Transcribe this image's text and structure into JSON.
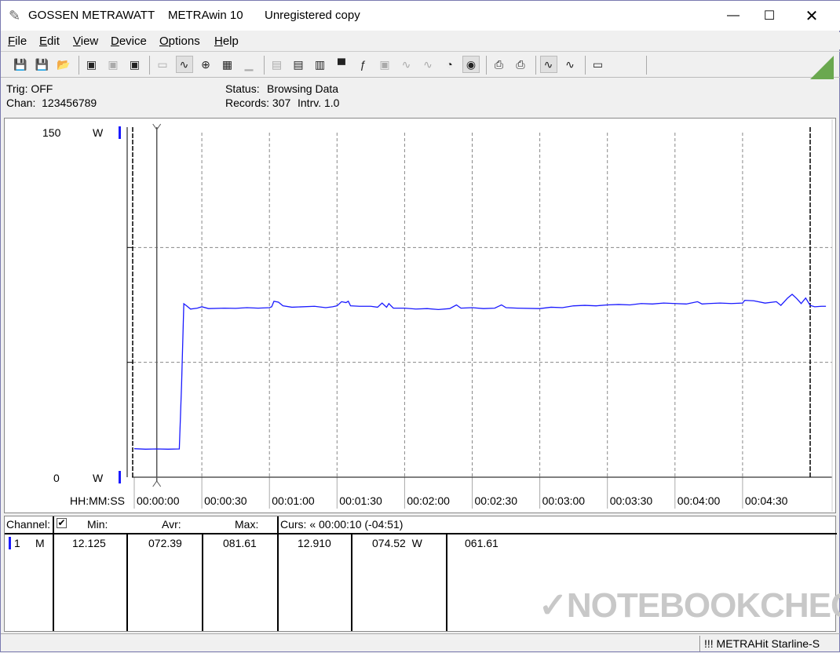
{
  "title": {
    "brand": "GOSSEN METRAWATT",
    "app": "METRAwin 10",
    "license": "Unregistered copy"
  },
  "menu": [
    {
      "label": "File",
      "key": "F"
    },
    {
      "label": "Edit",
      "key": "E"
    },
    {
      "label": "View",
      "key": "V"
    },
    {
      "label": "Device",
      "key": "D"
    },
    {
      "label": "Options",
      "key": "O"
    },
    {
      "label": "Help",
      "key": "H"
    }
  ],
  "toolbar": {
    "icons": [
      "save-as-icon",
      "save-icon",
      "open-folder-icon",
      "device-read-icon",
      "device-clear-icon",
      "memory-read-icon",
      "multimeter-icon",
      "waveform-view-icon",
      "crosshair-icon",
      "table-view-icon",
      "bar-chart-icon",
      "export-icon",
      "import-icon",
      "settings-icon",
      "monitor-icon",
      "function-icon",
      "display-icon",
      "sine-icon",
      "sine-bars-icon",
      "clock-icon",
      "timer-icon",
      "print-preview-icon",
      "print-icon",
      "zoom-wave-icon",
      "zoom-fit-icon",
      "comment-icon"
    ]
  },
  "info": {
    "trig": "Trig: OFF",
    "chan": "Chan:  123456789",
    "status_label": "Status:",
    "status_value": "Browsing Data",
    "records": "Records: 307",
    "interval": "Intrv. 1.0"
  },
  "chart_data": {
    "type": "line",
    "ylabel": "W",
    "ylim": [
      0,
      150
    ],
    "ytick_labels": [
      "150",
      "0"
    ],
    "yunit_top": "W",
    "yunit_bottom": "W",
    "xlabel": "HH:MM:SS",
    "xlim": [
      0,
      307
    ],
    "xticks": [
      0,
      30,
      60,
      90,
      120,
      150,
      180,
      210,
      240,
      270
    ],
    "xtick_labels": [
      "00:00:00",
      "00:00:30",
      "00:01:00",
      "00:01:30",
      "00:02:00",
      "00:02:30",
      "00:03:00",
      "00:03:30",
      "00:04:00",
      "00:04:30"
    ],
    "cursor_t": 10,
    "line_color": "#1a1aff",
    "series": [
      {
        "name": "Channel 1",
        "points": [
          [
            0,
            12.4
          ],
          [
            5,
            12.2
          ],
          [
            10,
            12.3
          ],
          [
            15,
            12.2
          ],
          [
            20,
            12.3
          ],
          [
            21,
            40
          ],
          [
            22,
            75.5
          ],
          [
            23,
            74.8
          ],
          [
            25,
            73.2
          ],
          [
            28,
            73.6
          ],
          [
            30,
            74.2
          ],
          [
            33,
            73.4
          ],
          [
            40,
            73.6
          ],
          [
            45,
            73.5
          ],
          [
            50,
            73.8
          ],
          [
            55,
            73.6
          ],
          [
            60,
            73.8
          ],
          [
            61,
            74.2
          ],
          [
            62,
            76.6
          ],
          [
            64,
            76.2
          ],
          [
            66,
            74.6
          ],
          [
            70,
            74.0
          ],
          [
            80,
            74.4
          ],
          [
            85,
            73.8
          ],
          [
            88,
            74.2
          ],
          [
            90,
            74.6
          ],
          [
            92,
            76.4
          ],
          [
            94,
            76.0
          ],
          [
            95,
            76.6
          ],
          [
            96,
            74.6
          ],
          [
            100,
            74.4
          ],
          [
            105,
            74.4
          ],
          [
            108,
            74.0
          ],
          [
            110,
            75.8
          ],
          [
            112,
            74.0
          ],
          [
            113,
            75.6
          ],
          [
            115,
            73.6
          ],
          [
            120,
            73.6
          ],
          [
            125,
            73.2
          ],
          [
            130,
            73.4
          ],
          [
            135,
            73.0
          ],
          [
            140,
            73.4
          ],
          [
            143,
            75.0
          ],
          [
            145,
            73.6
          ],
          [
            150,
            73.8
          ],
          [
            155,
            73.4
          ],
          [
            160,
            73.6
          ],
          [
            163,
            75.0
          ],
          [
            165,
            73.8
          ],
          [
            170,
            73.6
          ],
          [
            180,
            73.4
          ],
          [
            185,
            74.0
          ],
          [
            190,
            73.8
          ],
          [
            195,
            74.6
          ],
          [
            200,
            74.8
          ],
          [
            205,
            74.6
          ],
          [
            210,
            75.0
          ],
          [
            215,
            75.2
          ],
          [
            220,
            75.0
          ],
          [
            225,
            75.6
          ],
          [
            230,
            75.4
          ],
          [
            235,
            75.8
          ],
          [
            240,
            75.6
          ],
          [
            245,
            75.4
          ],
          [
            250,
            76.4
          ],
          [
            252,
            75.4
          ],
          [
            255,
            75.6
          ],
          [
            260,
            75.8
          ],
          [
            265,
            75.6
          ],
          [
            270,
            75.8
          ],
          [
            271,
            77.0
          ],
          [
            275,
            76.8
          ],
          [
            280,
            75.8
          ],
          [
            285,
            76.4
          ],
          [
            287,
            74.8
          ],
          [
            290,
            78.0
          ],
          [
            292,
            79.6
          ],
          [
            294,
            77.8
          ],
          [
            296,
            75.6
          ],
          [
            298,
            78.0
          ],
          [
            300,
            74.8
          ],
          [
            302,
            74.2
          ],
          [
            305,
            74.4
          ],
          [
            307,
            74.4
          ]
        ]
      }
    ]
  },
  "table": {
    "headers": {
      "channel": "Channel:",
      "min": "Min:",
      "avr": "Avr:",
      "max": "Max:",
      "curs": "Curs: « 00:00:10 (-04:51)"
    },
    "row": {
      "num": "1",
      "mode": "M",
      "min": "12.125",
      "avr": "072.39",
      "max": "081.61",
      "curs_val": "12.910",
      "curs_avr": "074.52  W",
      "curs_max": "061.61"
    },
    "channel_color": "#1a1aff"
  },
  "statusbar": {
    "device": "!!! METRAHit Starline-S"
  },
  "watermark": "NOTEBOOKCHECK"
}
